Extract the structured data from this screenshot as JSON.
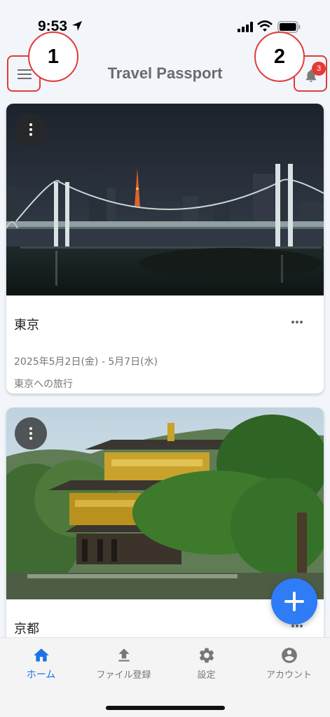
{
  "status_bar": {
    "time": "9:53",
    "icons": [
      "location-arrow-icon",
      "signal-icon",
      "wifi-icon",
      "battery-icon"
    ]
  },
  "header": {
    "title": "Travel Passport",
    "menu_icon": "hamburger-menu-icon",
    "notification_icon": "bell-icon",
    "notification_count": "3"
  },
  "annotations": {
    "callout_1": "1",
    "callout_2": "2",
    "highlight_color": "#e23b3b"
  },
  "trips": [
    {
      "title": "東京",
      "dates": "2025年5月2日(金) - 5月7日(水)",
      "description": "東京への旅行",
      "image": "night-city-bridge-photo"
    },
    {
      "title": "京都",
      "dates": "",
      "description": "",
      "image": "golden-pavilion-photo"
    }
  ],
  "fab": {
    "icon": "plus-icon",
    "color": "#2e7cf6"
  },
  "bottom_nav": {
    "items": [
      {
        "label": "ホーム",
        "icon": "home-icon",
        "active": true
      },
      {
        "label": "ファイル登録",
        "icon": "upload-icon",
        "active": false
      },
      {
        "label": "設定",
        "icon": "gear-icon",
        "active": false
      },
      {
        "label": "アカウント",
        "icon": "account-icon",
        "active": false
      }
    ],
    "active_color": "#1a73e8"
  }
}
